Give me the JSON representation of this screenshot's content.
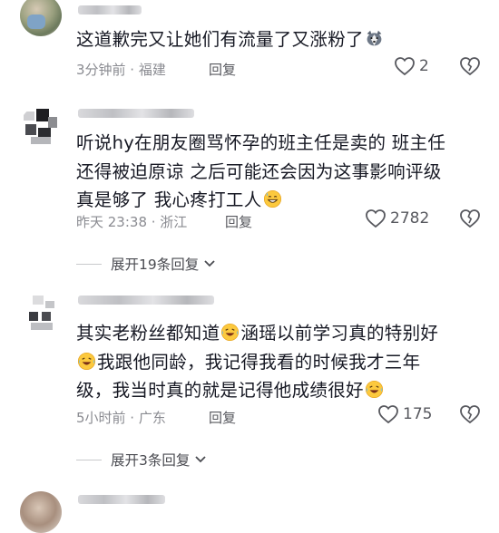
{
  "comments": [
    {
      "text_before_emoji": "这道歉完又让她们有流量了又涨粉了",
      "emoji_name": "husky-face-emoji",
      "time": "3分钟前 · 福建",
      "reply_label": "回复",
      "like_count": "2",
      "like_icon": "heart-outline-icon",
      "dislike_icon": "broken-heart-icon"
    },
    {
      "text_line1": "听说hy在朋友圈骂怀孕的班主任是卖的 班主任",
      "text_line2": "还得被迫原谅 之后可能还会因为这事影响评级",
      "text_line3": "真是够了 我心疼打工人",
      "emoji_name": "grinning-sweat-emoji",
      "time": "昨天 23:38 · 浙江",
      "reply_label": "回复",
      "like_count": "2782",
      "expand_label": "展开19条回复",
      "chevron_icon": "chevron-down-icon"
    },
    {
      "line1_a": "其实老粉丝都知道",
      "line1_b": "涵瑶以前学习真的特别好",
      "line2": "我跟他同龄，我记得我看的时候我才三年",
      "line3": "级，我当时真的就是记得他成绩很好",
      "emoji_name": "crying-laughing-emoji",
      "time": "5小时前 · 广东",
      "reply_label": "回复",
      "like_count": "175",
      "expand_label": "展开3条回复"
    }
  ],
  "colors": {
    "text": "#161823",
    "meta": "#8a8b91",
    "icon": "#57585e"
  }
}
